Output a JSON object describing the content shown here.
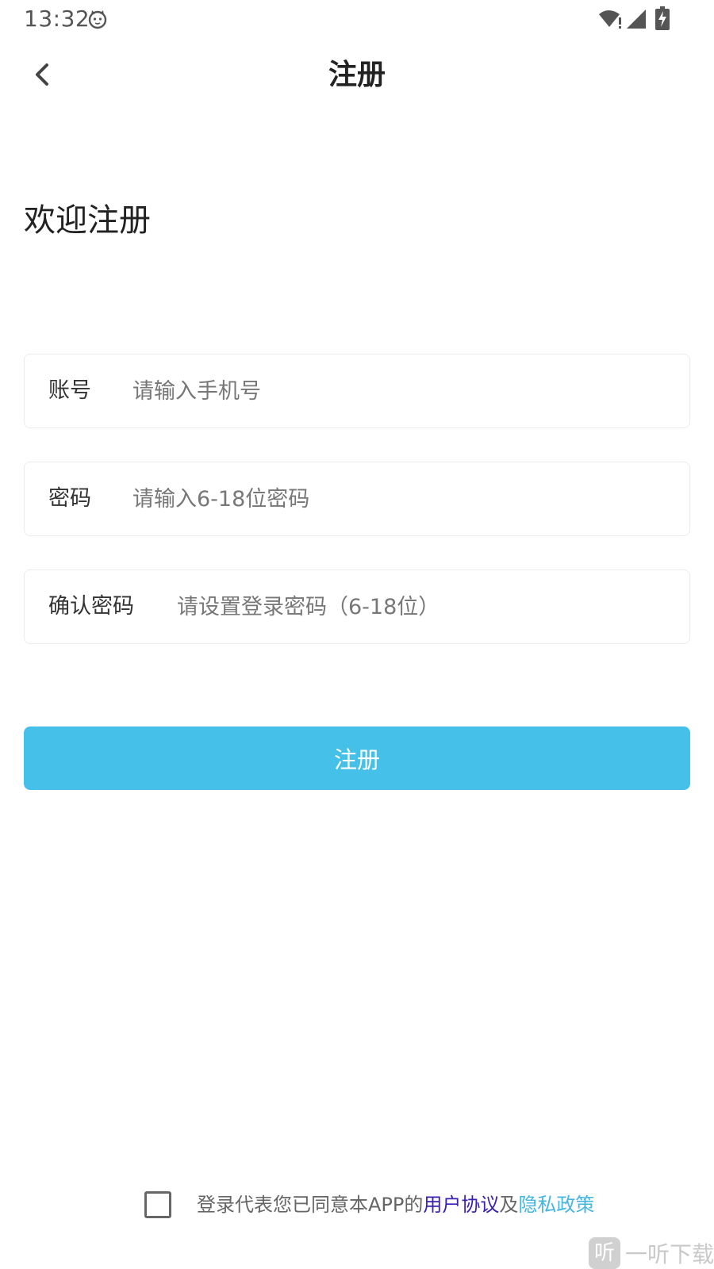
{
  "status_bar": {
    "time": "13:32"
  },
  "nav": {
    "title": "注册"
  },
  "welcome": "欢迎注册",
  "form": {
    "account": {
      "label": "账号",
      "placeholder": "请输入手机号"
    },
    "password": {
      "label": "密码",
      "placeholder": "请输入6-18位密码"
    },
    "confirm": {
      "label": "确认密码",
      "placeholder": "请设置登录密码（6-18位）"
    },
    "submit_label": "注册"
  },
  "agreement": {
    "prefix": "登录代表您已同意本APP的",
    "user_agreement": "用户协议",
    "conjunction": "及",
    "privacy_policy": "隐私政策",
    "checked": false
  },
  "watermark": {
    "logo_glyph": "听",
    "text": "一听下载"
  },
  "colors": {
    "accent": "#45c0e8",
    "user_agreement_link": "#3a1fb0",
    "privacy_link": "#45b6e0"
  },
  "icons": {
    "back": "chevron-left-icon",
    "status_app": "cat-face-icon",
    "wifi": "wifi-icon",
    "signal": "cellular-signal-icon",
    "battery": "battery-charging-icon"
  }
}
